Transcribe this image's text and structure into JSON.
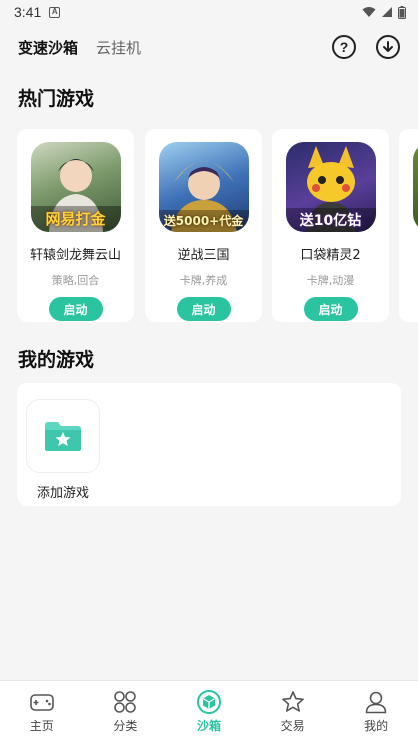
{
  "status_bar": {
    "time": "3:41",
    "notification_icon": "A"
  },
  "header": {
    "tabs": [
      {
        "label": "变速沙箱",
        "active": true
      },
      {
        "label": "云挂机",
        "active": false
      }
    ],
    "help_icon": "question-circle-icon",
    "download_icon": "download-circle-icon"
  },
  "hot_games": {
    "title": "热门游戏",
    "items": [
      {
        "name": "轩辕剑龙舞云山",
        "tags": "策略,回合",
        "button": "启动",
        "banner": "网易打金",
        "bg": "#5d7a54"
      },
      {
        "name": "逆战三国",
        "tags": "卡牌,养成",
        "button": "启动",
        "banner": "送5000+代金",
        "bg": "#3b67a8"
      },
      {
        "name": "口袋精灵2",
        "tags": "卡牌,动漫",
        "button": "启动",
        "banner": "送10亿钻",
        "bg": "#6a4fa3"
      }
    ]
  },
  "my_games": {
    "title": "我的游戏",
    "add_label": "添加游戏"
  },
  "bottom_nav": [
    {
      "label": "主页",
      "icon": "gamepad-icon",
      "active": false
    },
    {
      "label": "分类",
      "icon": "grid-icon",
      "active": false
    },
    {
      "label": "沙箱",
      "icon": "box-icon",
      "active": true
    },
    {
      "label": "交易",
      "icon": "star-icon",
      "active": false
    },
    {
      "label": "我的",
      "icon": "user-icon",
      "active": false
    }
  ],
  "colors": {
    "accent": "#2ac4a1",
    "background": "#f5f5f5"
  }
}
